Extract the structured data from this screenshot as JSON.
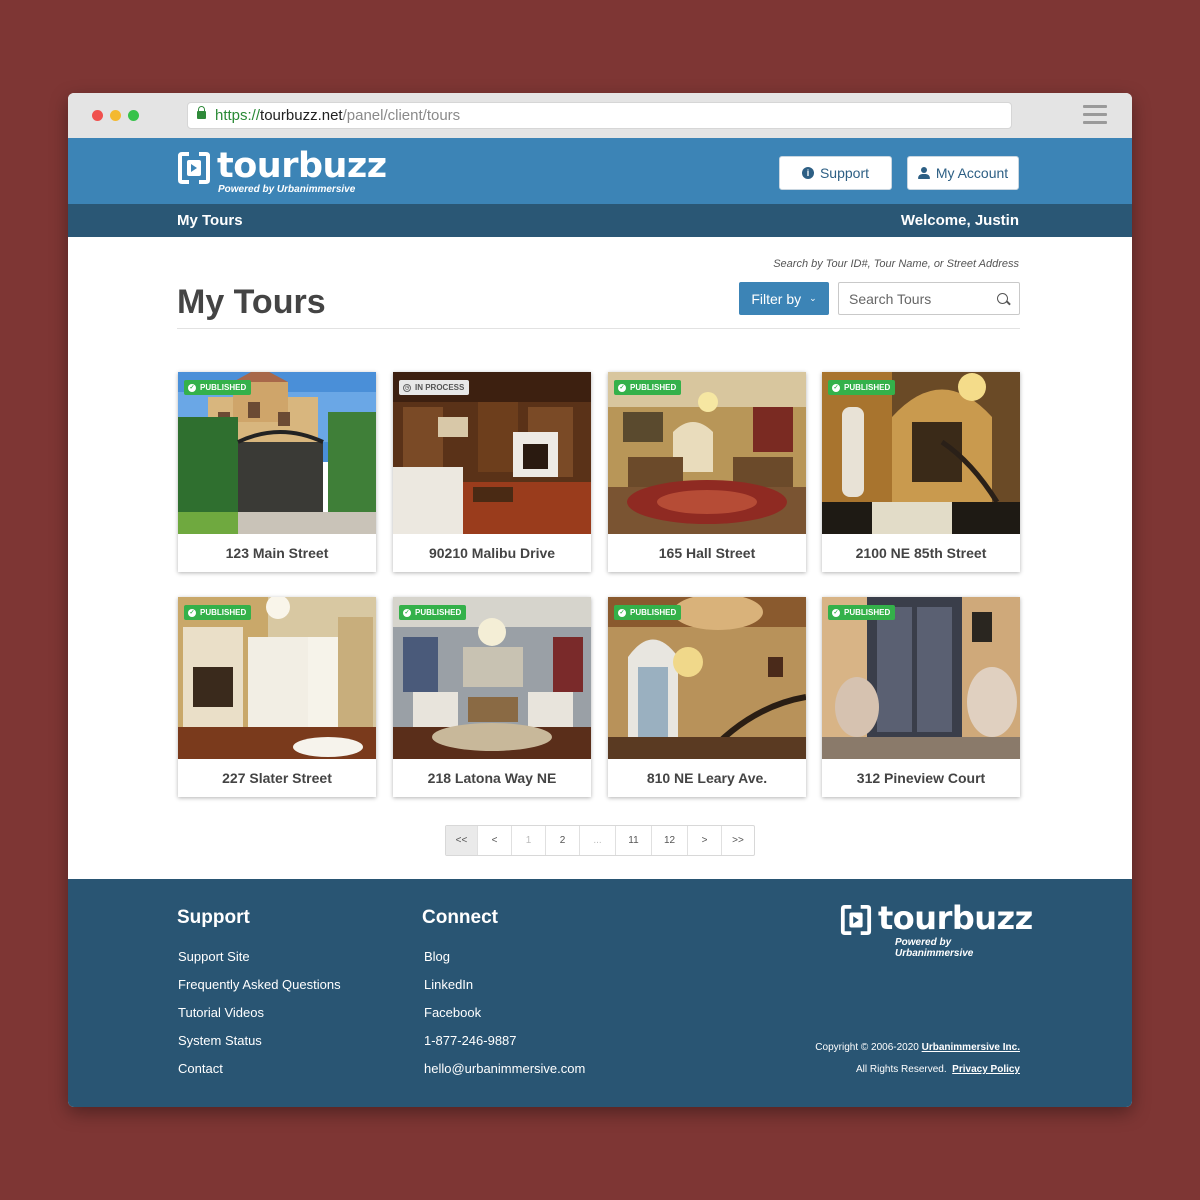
{
  "browser": {
    "url_scheme": "https://",
    "url_host": "tourbuzz.net",
    "url_path": "/panel/client/tours"
  },
  "header": {
    "logo_text": "tourbuzz",
    "logo_sub": "Powered by Urbanimmersive",
    "support_label": "Support",
    "account_label": "My Account",
    "brand_color": "#3c84b6"
  },
  "subnav": {
    "left": "My Tours",
    "right": "Welcome, Justin"
  },
  "main": {
    "title": "My Tours",
    "search_hint": "Search by Tour ID#, Tour Name, or Street Address",
    "filter_label": "Filter by",
    "search_placeholder": "Search Tours"
  },
  "tours": [
    {
      "name": "123 Main Street",
      "status": "PUBLISHED"
    },
    {
      "name": "90210 Malibu Drive",
      "status": "IN PROCESS"
    },
    {
      "name": "165 Hall Street",
      "status": "PUBLISHED"
    },
    {
      "name": "2100 NE 85th Street",
      "status": "PUBLISHED"
    },
    {
      "name": "227 Slater Street",
      "status": "PUBLISHED"
    },
    {
      "name": "218 Latona Way NE",
      "status": "PUBLISHED"
    },
    {
      "name": "810 NE Leary Ave.",
      "status": "PUBLISHED"
    },
    {
      "name": "312 Pineview Court",
      "status": "PUBLISHED"
    }
  ],
  "pagination": [
    "<<",
    "<",
    "1",
    "2",
    "...",
    "11",
    "12",
    ">",
    ">>"
  ],
  "footer": {
    "support_head": "Support",
    "support_links": [
      "Support Site",
      "Frequently Asked Questions",
      "Tutorial Videos",
      "System Status",
      "Contact"
    ],
    "connect_head": "Connect",
    "connect_links": [
      "Blog",
      "LinkedIn",
      "Facebook",
      "1-877-246-9887",
      "hello@urbanimmersive.com"
    ],
    "logo_text": "tourbuzz",
    "logo_sub": "Powered by Urbanimmersive",
    "copyright_prefix": "Copyright © 2006-2020",
    "copyright_link": "Urbanimmersive Inc.",
    "rights_prefix": "All Rights Reserved.",
    "privacy_link": "Privacy Policy"
  }
}
